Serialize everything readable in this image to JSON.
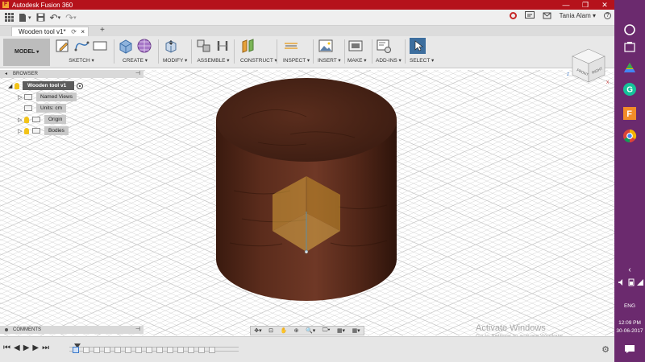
{
  "app": {
    "title": "Autodesk Fusion 360",
    "icon_letter": "F"
  },
  "window_controls": {
    "minimize": "—",
    "restore": "❐",
    "close": "✕"
  },
  "quick_access": {
    "user": "Tania Alam",
    "user_caret": "▾",
    "undo": "↶",
    "redo": "↷",
    "caret": "▾"
  },
  "document_tab": {
    "name": "Wooden tool v1*",
    "close": "×",
    "sync": "⟳",
    "new_tab": "+"
  },
  "workspace": {
    "label": "MODEL",
    "caret": "▾"
  },
  "toolbar_groups": [
    {
      "label": "SKETCH ▾"
    },
    {
      "label": "CREATE ▾"
    },
    {
      "label": "MODIFY ▾"
    },
    {
      "label": "ASSEMBLE ▾"
    },
    {
      "label": "CONSTRUCT ▾"
    },
    {
      "label": "INSPECT ▾"
    },
    {
      "label": "INSERT ▾"
    },
    {
      "label": "MAKE ▾"
    },
    {
      "label": "ADD-INS ▾"
    },
    {
      "label": "SELECT ▾"
    }
  ],
  "browser": {
    "title": "BROWSER",
    "collapse": "◂",
    "pin": "⊣",
    "root": "Wooden tool v1",
    "named_views": "Named Views",
    "units": "Units: cm",
    "origin": "Origin",
    "bodies": "Bodies"
  },
  "comments": {
    "title": "COMMENTS",
    "pin": "⊣"
  },
  "viewcube": {
    "front": "FRONT",
    "right": "RIGHT",
    "z": "Z",
    "x": "X"
  },
  "nav_tools": [
    "✥▾",
    "⊡",
    "✋",
    "⊕",
    "🔍▾",
    "🖵▾",
    "▦▾",
    "▦▾"
  ],
  "watermark": {
    "title": "Activate Windows",
    "subtitle": "Go to Settings to activate Windows."
  },
  "timeline": {
    "controls": [
      "⏮",
      "◀",
      "▶",
      "▶",
      "⏭"
    ],
    "feature_count": 14,
    "settings": "⚙"
  },
  "taskbar": {
    "lang": "ENG",
    "time": "12:09 PM",
    "date": "30-06-2017",
    "chevron": "‹"
  },
  "colors": {
    "titlebar": "#b5121b",
    "taskbar": "#6b2a6e",
    "wood_dark": "#3c1a10",
    "wood_light": "#6b3624",
    "origin_plane": "#d8a43a",
    "grid_line": "#c9c9c9"
  }
}
